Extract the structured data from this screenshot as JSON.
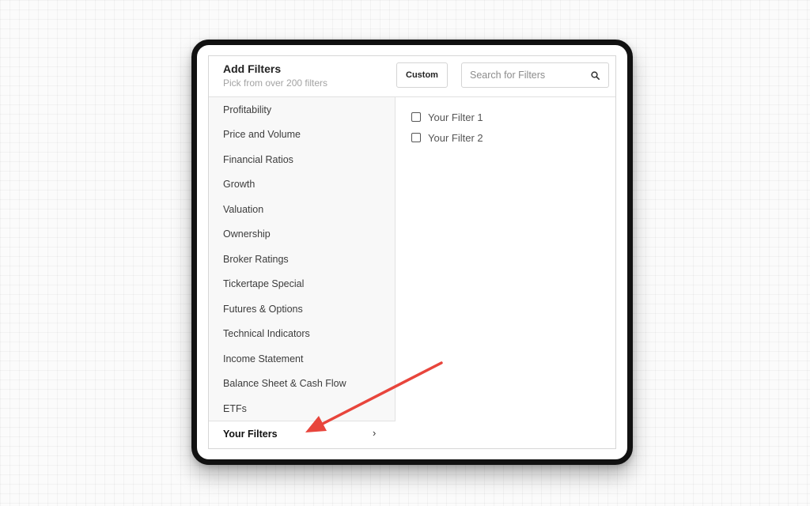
{
  "header": {
    "title": "Add Filters",
    "subtitle": "Pick from over 200 filters",
    "custom_label": "Custom",
    "search_placeholder": "Search for Filters"
  },
  "sidebar": {
    "items": [
      {
        "label": "Profitability"
      },
      {
        "label": "Price and Volume"
      },
      {
        "label": "Financial Ratios"
      },
      {
        "label": "Growth"
      },
      {
        "label": "Valuation"
      },
      {
        "label": "Ownership"
      },
      {
        "label": "Broker Ratings"
      },
      {
        "label": "Tickertape Special"
      },
      {
        "label": "Futures & Options"
      },
      {
        "label": "Technical Indicators"
      },
      {
        "label": "Income Statement"
      },
      {
        "label": "Balance Sheet & Cash Flow"
      },
      {
        "label": "ETFs"
      }
    ],
    "active_item": {
      "label": "Your Filters",
      "chevron": "›"
    }
  },
  "filters": [
    {
      "label": "Your Filter 1",
      "checked": false
    },
    {
      "label": "Your Filter 2",
      "checked": false
    }
  ],
  "colors": {
    "annotation_arrow": "#e8453c",
    "device_frame": "#111111",
    "sidebar_bg": "#f8f8f8"
  }
}
